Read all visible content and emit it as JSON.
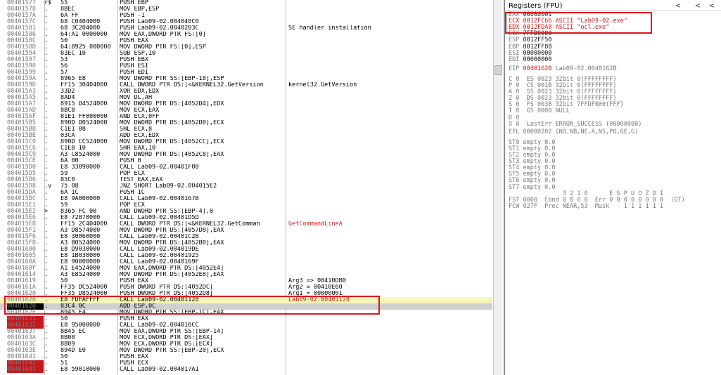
{
  "disasm": [
    {
      "addr": "00401577",
      "mark": "r$",
      "hex": "55",
      "asm": "PUSH EBP",
      "comment": ""
    },
    {
      "addr": "00401578",
      "mark": ".",
      "hex": "8BEC",
      "asm": "MOV EBP,ESP",
      "comment": ""
    },
    {
      "addr": "0040157A",
      "mark": ".",
      "hex": "6A FF",
      "asm": "PUSH -1",
      "comment": ""
    },
    {
      "addr": "0040157C",
      "mark": ".",
      "hex": "68 C0404000",
      "asm": "PUSH Lab09-02.004040C0",
      "comment": ""
    },
    {
      "addr": "00401581",
      "mark": ".",
      "hex": "68 3C204000",
      "asm": "PUSH Lab09-02.0040203C",
      "comment": "SE handler installation"
    },
    {
      "addr": "00401586",
      "mark": ".",
      "hex": "64:A1 0000000",
      "asm": "MOV EAX,DWORD PTR FS:[0]",
      "comment": ""
    },
    {
      "addr": "0040158C",
      "mark": ".",
      "hex": "50",
      "asm": "PUSH EAX",
      "comment": ""
    },
    {
      "addr": "0040158D",
      "mark": ".",
      "hex": "64:8925 000000",
      "asm": "MOV DWORD PTR FS:[0],ESP",
      "comment": ""
    },
    {
      "addr": "00401594",
      "mark": ".",
      "hex": "83EC 10",
      "asm": "SUB ESP,10",
      "comment": ""
    },
    {
      "addr": "00401597",
      "mark": ".",
      "hex": "53",
      "asm": "PUSH EBX",
      "comment": ""
    },
    {
      "addr": "00401598",
      "mark": ".",
      "hex": "56",
      "asm": "PUSH ESI",
      "comment": ""
    },
    {
      "addr": "00401599",
      "mark": ".",
      "hex": "57",
      "asm": "PUSH EDI",
      "comment": ""
    },
    {
      "addr": "0040159A",
      "mark": ".",
      "hex": "8965 E8",
      "asm": "MOV DWORD PTR SS:[EBP-18],ESP",
      "comment": ""
    },
    {
      "addr": "0040159D",
      "mark": ".",
      "hex": "FF15 30404000",
      "asm": "CALL DWORD PTR DS:[<&KERNEL32.GetVersion",
      "comment": "kernel32.GetVersion"
    },
    {
      "addr": "004015A3",
      "mark": ".",
      "hex": "33D2",
      "asm": "XOR EDX,EDX",
      "comment": ""
    },
    {
      "addr": "004015A5",
      "mark": ".",
      "hex": "8AD4",
      "asm": "MOV DL,AH",
      "comment": ""
    },
    {
      "addr": "004015A7",
      "mark": ".",
      "hex": "8915 D4524000",
      "asm": "MOV DWORD PTR DS:[4052D4],EDX",
      "comment": ""
    },
    {
      "addr": "004015AD",
      "mark": ".",
      "hex": "8BC8",
      "asm": "MOV ECX,EAX",
      "comment": ""
    },
    {
      "addr": "004015AF",
      "mark": ".",
      "hex": "81E1 FF000000",
      "asm": "AND ECX,0FF",
      "comment": ""
    },
    {
      "addr": "004015B5",
      "mark": ".",
      "hex": "890D D0524000",
      "asm": "MOV DWORD PTR DS:[4052D0],ECX",
      "comment": ""
    },
    {
      "addr": "004015BB",
      "mark": ".",
      "hex": "C1E1 08",
      "asm": "SHL ECX,8",
      "comment": ""
    },
    {
      "addr": "004015BE",
      "mark": ".",
      "hex": "03CA",
      "asm": "ADD ECX,EDX",
      "comment": ""
    },
    {
      "addr": "004015C0",
      "mark": ".",
      "hex": "890D CC524000",
      "asm": "MOV DWORD PTR DS:[4052CC],ECX",
      "comment": ""
    },
    {
      "addr": "004015C6",
      "mark": ".",
      "hex": "C1E8 10",
      "asm": "SHR EAX,10",
      "comment": ""
    },
    {
      "addr": "004015C9",
      "mark": ".",
      "hex": "A3 C8524000",
      "asm": "MOV DWORD PTR DS:[4052C8],EAX",
      "comment": ""
    },
    {
      "addr": "004015CE",
      "mark": ".",
      "hex": "6A 00",
      "asm": "PUSH 0",
      "comment": ""
    },
    {
      "addr": "004015D0",
      "mark": ".",
      "hex": "E8 33090000",
      "asm": "CALL Lab09-02.00401F08",
      "comment": ""
    },
    {
      "addr": "004015D5",
      "mark": ".",
      "hex": "59",
      "asm": "POP ECX",
      "comment": ""
    },
    {
      "addr": "004015D6",
      "mark": ".",
      "hex": "85C0",
      "asm": "TEST EAX,EAX",
      "comment": ""
    },
    {
      "addr": "004015D8",
      "mark": ".v",
      "hex": "75 08",
      "asm": "JNZ SHORT Lab09-02.004015E2",
      "comment": ""
    },
    {
      "addr": "004015DA",
      "mark": ".",
      "hex": "6A 1C",
      "asm": "PUSH 1C",
      "comment": ""
    },
    {
      "addr": "004015DC",
      "mark": ".",
      "hex": "E8 9A000000",
      "asm": "CALL Lab09-02.0040167B",
      "comment": ""
    },
    {
      "addr": "004015E1",
      "mark": ".",
      "hex": "59",
      "asm": "POP ECX",
      "comment": ""
    },
    {
      "addr": "004015E2",
      "mark": ">",
      "hex": "8365 FC 00",
      "asm": "AND DWORD PTR SS:[EBP-4],0",
      "comment": ""
    },
    {
      "addr": "004015E6",
      "mark": ".",
      "hex": "E8 72070000",
      "asm": "CALL Lab09-02.00401D5D",
      "comment": ""
    },
    {
      "addr": "004015EB",
      "mark": ".",
      "hex": "FF15 2C404000",
      "asm": "CALL DWORD PTR DS:[<&KERNEL32.GetComman",
      "comment": "GetCommandLineA"
    },
    {
      "addr": "004015F1",
      "mark": ".",
      "hex": "A3 D8574000",
      "asm": "MOV DWORD PTR DS:[4057D8],EAX",
      "comment": ""
    },
    {
      "addr": "004015F6",
      "mark": ".",
      "hex": "E8 30060000",
      "asm": "CALL Lab09-02.00401C2B",
      "comment": ""
    },
    {
      "addr": "004015FB",
      "mark": ".",
      "hex": "A3 B0524000",
      "asm": "MOV DWORD PTR DS:[4052B0],EAX",
      "comment": ""
    },
    {
      "addr": "00401600",
      "mark": ".",
      "hex": "E8 D9030000",
      "asm": "CALL Lab09-02.004019DE",
      "comment": ""
    },
    {
      "addr": "00401605",
      "mark": ".",
      "hex": "E8 1B030000",
      "asm": "CALL Lab09-02.00401925",
      "comment": ""
    },
    {
      "addr": "0040160A",
      "mark": ".",
      "hex": "E8 90000000",
      "asm": "CALL Lab09-02.0040169F",
      "comment": ""
    },
    {
      "addr": "0040160F",
      "mark": ".",
      "hex": "A1 E4524000",
      "asm": "MOV EAX,DWORD PTR DS:[4052E4]",
      "comment": ""
    },
    {
      "addr": "00401614",
      "mark": ".",
      "hex": "A3 E8524000",
      "asm": "MOV DWORD PTR DS:[4052E8],EAX",
      "comment": ""
    },
    {
      "addr": "00401619",
      "mark": ".",
      "hex": "50",
      "asm": "PUSH EAX",
      "comment": "Arg3 => 00410DB0"
    },
    {
      "addr": "0040161A",
      "mark": ".",
      "hex": "FF35 DC524000",
      "asm": "PUSH DWORD PTR DS:[4052DC]",
      "comment": "Arg2 = 00410E60"
    },
    {
      "addr": "00401620",
      "mark": ".",
      "hex": "FF35 D8524000",
      "asm": "PUSH DWORD PTR DS:[4052D8]",
      "comment": "Arg1 = 00000001"
    },
    {
      "addr": "00401626",
      "mark": ".",
      "hex": "E8 FDFAFFFF",
      "asm": "CALL Lab09-02.00401128",
      "comment": "Lab09-02.00401128"
    },
    {
      "addr": "0040162B",
      "mark": ".",
      "hex": "83C4 0C",
      "asm": "ADD ESP,0C",
      "comment": ""
    },
    {
      "addr": "0040162E",
      "mark": ".",
      "hex": "8945 E4",
      "asm": "MOV DWORD PTR SS:[EBP-1C],EAX",
      "comment": ""
    },
    {
      "addr": "00401631",
      "mark": ".",
      "hex": "50",
      "asm": "PUSH EAX",
      "comment": ""
    },
    {
      "addr": "00401632",
      "mark": ".",
      "hex": "E8 95000000",
      "asm": "CALL Lab09-02.004016CC",
      "comment": ""
    },
    {
      "addr": "00401637",
      "mark": ".",
      "hex": "8B45 EC",
      "asm": "MOV EAX,DWORD PTR SS:[EBP-14]",
      "comment": ""
    },
    {
      "addr": "0040163A",
      "mark": ".",
      "hex": "8B08",
      "asm": "MOV ECX,DWORD PTR DS:[EAX]",
      "comment": ""
    },
    {
      "addr": "0040163C",
      "mark": ".",
      "hex": "8B09",
      "asm": "MOV ECX,DWORD PTR DS:[ECX]",
      "comment": ""
    },
    {
      "addr": "0040163E",
      "mark": ".",
      "hex": "894D E0",
      "asm": "MOV DWORD PTR SS:[EBP-20],ECX",
      "comment": ""
    },
    {
      "addr": "00401641",
      "mark": ".",
      "hex": "50",
      "asm": "PUSH EAX",
      "comment": ""
    },
    {
      "addr": "00401642",
      "mark": ".",
      "hex": "51",
      "asm": "PUSH ECX",
      "comment": ""
    },
    {
      "addr": "00401643",
      "mark": ".",
      "hex": "E8 59010000",
      "asm": "CALL Lab09-02.004017A1",
      "comment": ""
    }
  ],
  "registers": {
    "title": "Registers (FPU)",
    "nav": [
      "<",
      "<",
      "<"
    ],
    "gp": [
      {
        "name": "EAX",
        "value": "00000001",
        "extra": ""
      },
      {
        "name": "ECX",
        "value": "0012FC66",
        "extra": "ASCII \"Lab09-02.exe\""
      },
      {
        "name": "EDX",
        "value": "0012FDA8",
        "extra": "ASCII \"ocl.exe\""
      },
      {
        "name": "EBX",
        "value": "7FFD0000",
        "extra": ""
      },
      {
        "name": "ESP",
        "value": "0012FF50",
        "extra": ""
      },
      {
        "name": "EBP",
        "value": "0012FF88",
        "extra": ""
      },
      {
        "name": "ESI",
        "value": "00000000",
        "extra": ""
      },
      {
        "name": "EDI",
        "value": "00000000",
        "extra": ""
      }
    ],
    "eip": {
      "name": "EIP",
      "value": "0040162B",
      "extra": "Lab09-02.0040162B"
    },
    "flags": [
      "C 0  ES 0023 32bit 0(FFFFFFFF)",
      "P 0  CS 001B 32bit 0(FFFFFFFF)",
      "A 0  SS 0023 32bit 0(FFFFFFFF)",
      "Z 0  DS 0023 32bit 0(FFFFFFFF)",
      "S 0  FS 003B 32bit 7FFDF000(FFF)",
      "T 0  GS 0000 NULL",
      "D 0",
      "O 0  LastErr ERROR_SUCCESS (00000000)"
    ],
    "efl": "EFL 00000202 (NO,NB,NE,A,NS,PO,GE,G)",
    "fpu": [
      "ST0 empty 0.0",
      "ST1 empty 0.0",
      "ST2 empty 0.0",
      "ST3 empty 0.0",
      "ST4 empty 0.0",
      "ST5 empty 0.0",
      "ST6 empty 0.0",
      "ST7 empty 0.0"
    ],
    "fpu_header": "               3 2 1 0      E S P U O Z D I",
    "fst": "FST 0000  Cond 0 0 0 0  Err 0 0 0 0 0 0 0 0  (GT)",
    "fcw": "FCW 027F  Prec NEAR,53  Mask    1 1 1 1 1 1"
  },
  "colors": {
    "highlight_box": "#e3141b",
    "comment_red": "#d0211f",
    "current_line": "#d0d0d0",
    "call_line": "#f6f6b8"
  }
}
